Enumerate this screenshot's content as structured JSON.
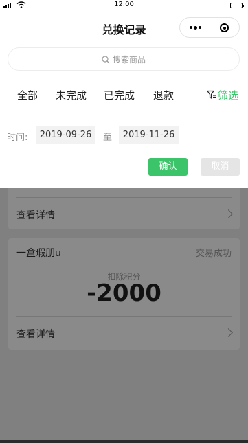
{
  "status_bar": {
    "time": "12:00"
  },
  "navbar": {
    "title": "兑换记录"
  },
  "search": {
    "placeholder": "搜索商品"
  },
  "tabs": [
    {
      "label": "全部"
    },
    {
      "label": "未完成"
    },
    {
      "label": "已完成"
    },
    {
      "label": "退款"
    }
  ],
  "filter": {
    "label": "筛选"
  },
  "date_filter": {
    "label": "时间:",
    "start": "2019-09-26",
    "separator": "至",
    "end": "2019-11-26"
  },
  "actions": {
    "confirm": "确认",
    "cancel": "取消"
  },
  "orders": [
    {
      "detail_label": "查看详情"
    },
    {
      "product": "一盒瑕朋u",
      "status": "交易成功",
      "points_label": "扣除积分",
      "points": "-2000",
      "detail_label": "查看详情"
    }
  ],
  "colors": {
    "accent": "#3cc46a",
    "overlay": "#808080"
  }
}
